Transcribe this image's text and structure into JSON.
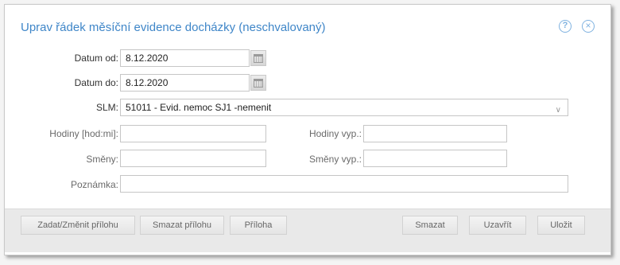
{
  "dialog": {
    "title": "Uprav řádek měsíční evidence docházky (neschvalovaný)",
    "help_icon": "question-circle-icon",
    "close_icon": "close-circle-icon"
  },
  "form": {
    "datum_od": {
      "label": "Datum od:",
      "value": "8.12.2020",
      "icon": "calendar-icon"
    },
    "datum_do": {
      "label": "Datum do:",
      "value": "8.12.2020",
      "icon": "calendar-icon"
    },
    "slm": {
      "label": "SLM:",
      "value": "51011 - Evid. nemoc SJ1 -nemenit",
      "icon": "chevron-down-icon"
    },
    "hodiny": {
      "label": "Hodiny [hod:mi]:",
      "value": ""
    },
    "hodiny_vyp": {
      "label": "Hodiny vyp.:",
      "value": ""
    },
    "smeny": {
      "label": "Směny:",
      "value": ""
    },
    "smeny_vyp": {
      "label": "Směny vyp.:",
      "value": ""
    },
    "poznamka": {
      "label": "Poznámka:",
      "value": ""
    }
  },
  "buttons": {
    "zadat": "Zadat/Změnit přílohu",
    "smazat_prilohu": "Smazat přílohu",
    "priloha": "Příloha",
    "smazat": "Smazat",
    "uzavrit": "Uzavřít",
    "ulozit": "Uložit"
  },
  "colors": {
    "title": "#3f86c8",
    "icon": "#7fb2e0",
    "footer_bg": "#e9e9e9"
  }
}
